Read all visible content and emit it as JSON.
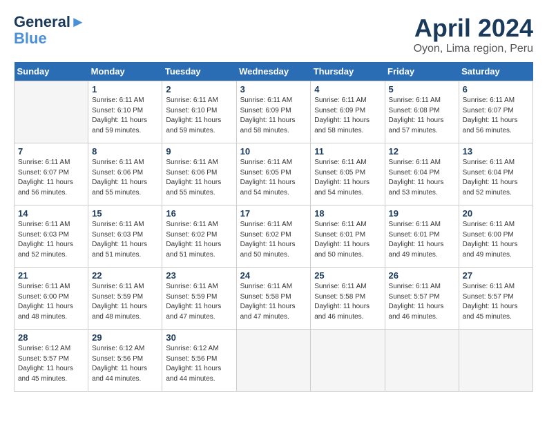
{
  "header": {
    "logo_line1": "General",
    "logo_line2": "Blue",
    "month_year": "April 2024",
    "location": "Oyon, Lima region, Peru"
  },
  "weekdays": [
    "Sunday",
    "Monday",
    "Tuesday",
    "Wednesday",
    "Thursday",
    "Friday",
    "Saturday"
  ],
  "weeks": [
    [
      {
        "day": "",
        "info": ""
      },
      {
        "day": "1",
        "info": "Sunrise: 6:11 AM\nSunset: 6:10 PM\nDaylight: 11 hours\nand 59 minutes."
      },
      {
        "day": "2",
        "info": "Sunrise: 6:11 AM\nSunset: 6:10 PM\nDaylight: 11 hours\nand 59 minutes."
      },
      {
        "day": "3",
        "info": "Sunrise: 6:11 AM\nSunset: 6:09 PM\nDaylight: 11 hours\nand 58 minutes."
      },
      {
        "day": "4",
        "info": "Sunrise: 6:11 AM\nSunset: 6:09 PM\nDaylight: 11 hours\nand 58 minutes."
      },
      {
        "day": "5",
        "info": "Sunrise: 6:11 AM\nSunset: 6:08 PM\nDaylight: 11 hours\nand 57 minutes."
      },
      {
        "day": "6",
        "info": "Sunrise: 6:11 AM\nSunset: 6:07 PM\nDaylight: 11 hours\nand 56 minutes."
      }
    ],
    [
      {
        "day": "7",
        "info": "Sunrise: 6:11 AM\nSunset: 6:07 PM\nDaylight: 11 hours\nand 56 minutes."
      },
      {
        "day": "8",
        "info": "Sunrise: 6:11 AM\nSunset: 6:06 PM\nDaylight: 11 hours\nand 55 minutes."
      },
      {
        "day": "9",
        "info": "Sunrise: 6:11 AM\nSunset: 6:06 PM\nDaylight: 11 hours\nand 55 minutes."
      },
      {
        "day": "10",
        "info": "Sunrise: 6:11 AM\nSunset: 6:05 PM\nDaylight: 11 hours\nand 54 minutes."
      },
      {
        "day": "11",
        "info": "Sunrise: 6:11 AM\nSunset: 6:05 PM\nDaylight: 11 hours\nand 54 minutes."
      },
      {
        "day": "12",
        "info": "Sunrise: 6:11 AM\nSunset: 6:04 PM\nDaylight: 11 hours\nand 53 minutes."
      },
      {
        "day": "13",
        "info": "Sunrise: 6:11 AM\nSunset: 6:04 PM\nDaylight: 11 hours\nand 52 minutes."
      }
    ],
    [
      {
        "day": "14",
        "info": "Sunrise: 6:11 AM\nSunset: 6:03 PM\nDaylight: 11 hours\nand 52 minutes."
      },
      {
        "day": "15",
        "info": "Sunrise: 6:11 AM\nSunset: 6:03 PM\nDaylight: 11 hours\nand 51 minutes."
      },
      {
        "day": "16",
        "info": "Sunrise: 6:11 AM\nSunset: 6:02 PM\nDaylight: 11 hours\nand 51 minutes."
      },
      {
        "day": "17",
        "info": "Sunrise: 6:11 AM\nSunset: 6:02 PM\nDaylight: 11 hours\nand 50 minutes."
      },
      {
        "day": "18",
        "info": "Sunrise: 6:11 AM\nSunset: 6:01 PM\nDaylight: 11 hours\nand 50 minutes."
      },
      {
        "day": "19",
        "info": "Sunrise: 6:11 AM\nSunset: 6:01 PM\nDaylight: 11 hours\nand 49 minutes."
      },
      {
        "day": "20",
        "info": "Sunrise: 6:11 AM\nSunset: 6:00 PM\nDaylight: 11 hours\nand 49 minutes."
      }
    ],
    [
      {
        "day": "21",
        "info": "Sunrise: 6:11 AM\nSunset: 6:00 PM\nDaylight: 11 hours\nand 48 minutes."
      },
      {
        "day": "22",
        "info": "Sunrise: 6:11 AM\nSunset: 5:59 PM\nDaylight: 11 hours\nand 48 minutes."
      },
      {
        "day": "23",
        "info": "Sunrise: 6:11 AM\nSunset: 5:59 PM\nDaylight: 11 hours\nand 47 minutes."
      },
      {
        "day": "24",
        "info": "Sunrise: 6:11 AM\nSunset: 5:58 PM\nDaylight: 11 hours\nand 47 minutes."
      },
      {
        "day": "25",
        "info": "Sunrise: 6:11 AM\nSunset: 5:58 PM\nDaylight: 11 hours\nand 46 minutes."
      },
      {
        "day": "26",
        "info": "Sunrise: 6:11 AM\nSunset: 5:57 PM\nDaylight: 11 hours\nand 46 minutes."
      },
      {
        "day": "27",
        "info": "Sunrise: 6:11 AM\nSunset: 5:57 PM\nDaylight: 11 hours\nand 45 minutes."
      }
    ],
    [
      {
        "day": "28",
        "info": "Sunrise: 6:12 AM\nSunset: 5:57 PM\nDaylight: 11 hours\nand 45 minutes."
      },
      {
        "day": "29",
        "info": "Sunrise: 6:12 AM\nSunset: 5:56 PM\nDaylight: 11 hours\nand 44 minutes."
      },
      {
        "day": "30",
        "info": "Sunrise: 6:12 AM\nSunset: 5:56 PM\nDaylight: 11 hours\nand 44 minutes."
      },
      {
        "day": "",
        "info": ""
      },
      {
        "day": "",
        "info": ""
      },
      {
        "day": "",
        "info": ""
      },
      {
        "day": "",
        "info": ""
      }
    ]
  ]
}
